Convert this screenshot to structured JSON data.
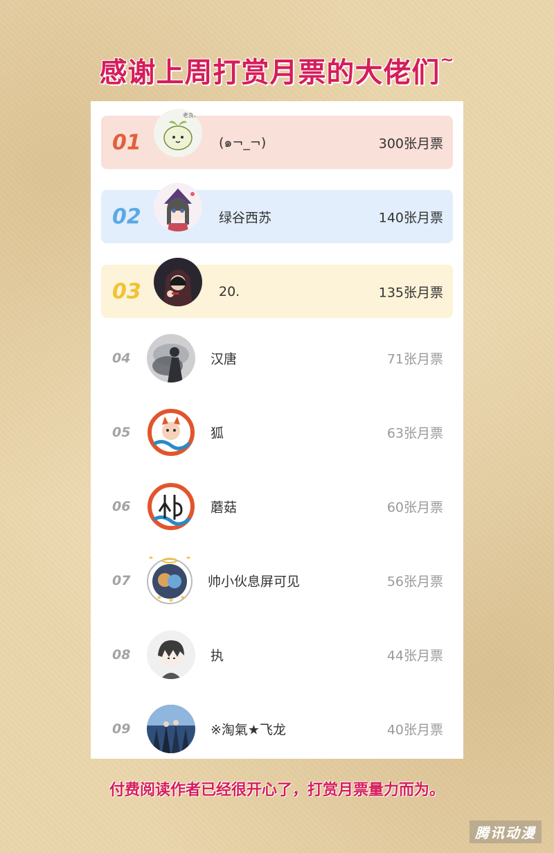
{
  "title": "感谢上周打赏月票的大佬们",
  "title_tilde": "~",
  "entries": [
    {
      "rank": "01",
      "name": "(๑¬_¬)",
      "votes": "300张月票",
      "avatar_style": "green-sprout-cartoon",
      "avatar_text": "老贪眼"
    },
    {
      "rank": "02",
      "name": "绿谷西苏",
      "votes": "140张月票",
      "avatar_style": "anime-girl-purple-hat"
    },
    {
      "rank": "03",
      "name": "20.",
      "votes": "135张月票",
      "avatar_style": "dark-hood-figure"
    },
    {
      "rank": "04",
      "name": "汉唐",
      "votes": "71张月票",
      "avatar_style": "smoky-figure"
    },
    {
      "rank": "05",
      "name": "狐",
      "votes": "63张月票",
      "avatar_style": "fox-wave-circle"
    },
    {
      "rank": "06",
      "name": "蘑菇",
      "votes": "60张月票",
      "avatar_style": "calligraphy-wave-circle"
    },
    {
      "rank": "07",
      "name": "帅小伙息屏可见",
      "votes": "56张月票",
      "avatar_style": "ornate-frame-stars"
    },
    {
      "rank": "08",
      "name": "执",
      "votes": "44张月票",
      "avatar_style": "anime-boy-sketch"
    },
    {
      "rank": "09",
      "name": "※淘氣★飞龙",
      "votes": "40张月票",
      "avatar_style": "game-characters-group"
    }
  ],
  "footer": "付费阅读作者已经很开心了，打赏月票量力而为。",
  "watermark": "腾讯动漫",
  "colors": {
    "accent": "#d51d5a",
    "rank1": "#e0603b",
    "rank2": "#5aa9e6",
    "rank3": "#f1c232",
    "rank1_bg": "#f9e0d8",
    "rank2_bg": "#e2eefb",
    "rank3_bg": "#fcf3d8"
  }
}
